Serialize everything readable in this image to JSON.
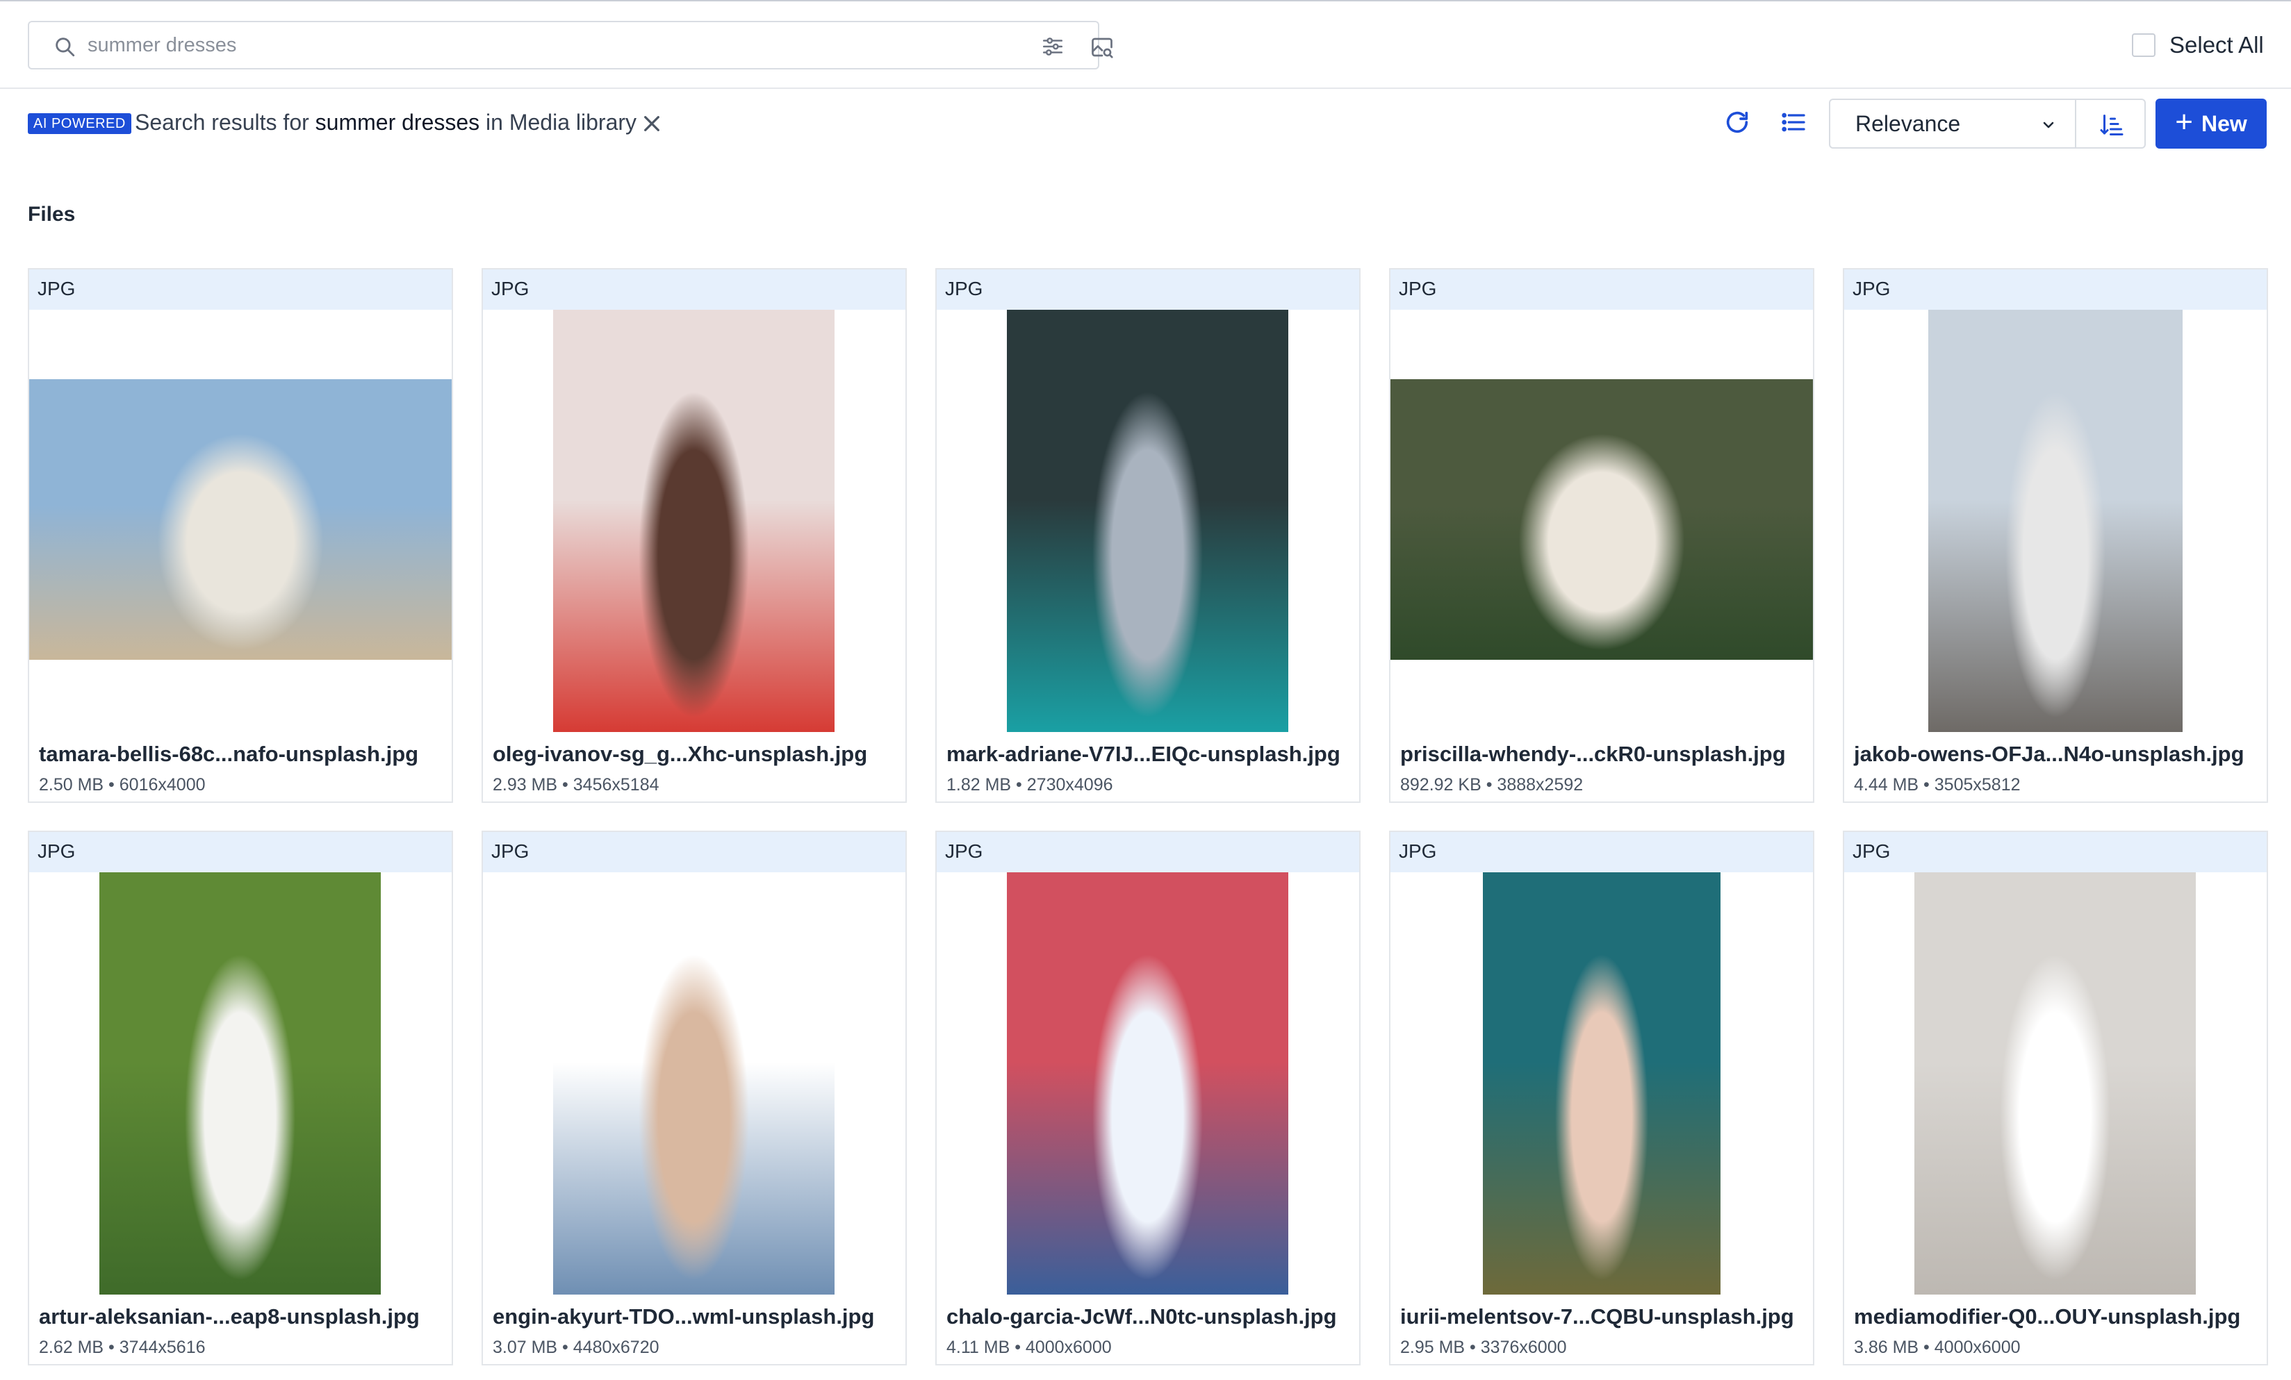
{
  "search": {
    "placeholder": "summer dresses"
  },
  "select_all": {
    "label": "Select All"
  },
  "toolbar": {
    "badge": "AI POWERED",
    "results_prefix": "Search results for",
    "query": "summer dresses",
    "results_in": "in",
    "location": "Media library",
    "sort_label": "Relevance",
    "new_label": "New"
  },
  "section": {
    "title": "Files"
  },
  "accent_color": "#1d4ed8",
  "icons": [
    "search-icon",
    "filter-icon",
    "image-search-icon",
    "close-icon",
    "refresh-icon",
    "list-view-icon",
    "chevron-down-icon",
    "sort-direction-icon",
    "plus-icon"
  ],
  "files": [
    {
      "type": "JPG",
      "name": "tamara-bellis-68c...nafo-unsplash.jpg",
      "size": "2.50 MB",
      "dims": "6016x4000",
      "palette": [
        "#8fb4d6",
        "#c9b79a",
        "#e9e5dc"
      ]
    },
    {
      "type": "JPG",
      "name": "oleg-ivanov-sg_g...Xhc-unsplash.jpg",
      "size": "2.93 MB",
      "dims": "3456x5184",
      "palette": [
        "#e9dcda",
        "#d63b34",
        "#5a3a30"
      ]
    },
    {
      "type": "JPG",
      "name": "mark-adriane-V7IJ...EIQc-unsplash.jpg",
      "size": "1.82 MB",
      "dims": "2730x4096",
      "palette": [
        "#2a3a3c",
        "#1aa0a4",
        "#a9b3bf"
      ]
    },
    {
      "type": "JPG",
      "name": "priscilla-whendy-...ckR0-unsplash.jpg",
      "size": "892.92 KB",
      "dims": "3888x2592",
      "palette": [
        "#4d5a3e",
        "#2f4a2a",
        "#ece6dc"
      ]
    },
    {
      "type": "JPG",
      "name": "jakob-owens-OFJa...N4o-unsplash.jpg",
      "size": "4.44 MB",
      "dims": "3505x5812",
      "palette": [
        "#c9d3dd",
        "#6e6a66",
        "#e7e7e7"
      ]
    },
    {
      "type": "JPG",
      "name": "artur-aleksanian-...eap8-unsplash.jpg",
      "size": "2.62 MB",
      "dims": "3744x5616",
      "palette": [
        "#5f8a35",
        "#3f6b2a",
        "#f3f3f0"
      ]
    },
    {
      "type": "JPG",
      "name": "engin-akyurt-TDO...wmI-unsplash.jpg",
      "size": "3.07 MB",
      "dims": "4480x6720",
      "palette": [
        "#ffffff",
        "#6f8fb3",
        "#d9b8a0"
      ]
    },
    {
      "type": "JPG",
      "name": "chalo-garcia-JcWf...N0tc-unsplash.jpg",
      "size": "4.11 MB",
      "dims": "4000x6000",
      "palette": [
        "#d2505f",
        "#3a5f9a",
        "#eef3fb"
      ]
    },
    {
      "type": "JPG",
      "name": "iurii-melentsov-7...CQBU-unsplash.jpg",
      "size": "2.95 MB",
      "dims": "3376x6000",
      "palette": [
        "#1f6e78",
        "#6e6a3a",
        "#e8c9b8"
      ]
    },
    {
      "type": "JPG",
      "name": "mediamodifier-Q0...OUY-unsplash.jpg",
      "size": "3.86 MB",
      "dims": "4000x6000",
      "palette": [
        "#d9d6d2",
        "#bdb8b2",
        "#ffffff"
      ]
    }
  ]
}
